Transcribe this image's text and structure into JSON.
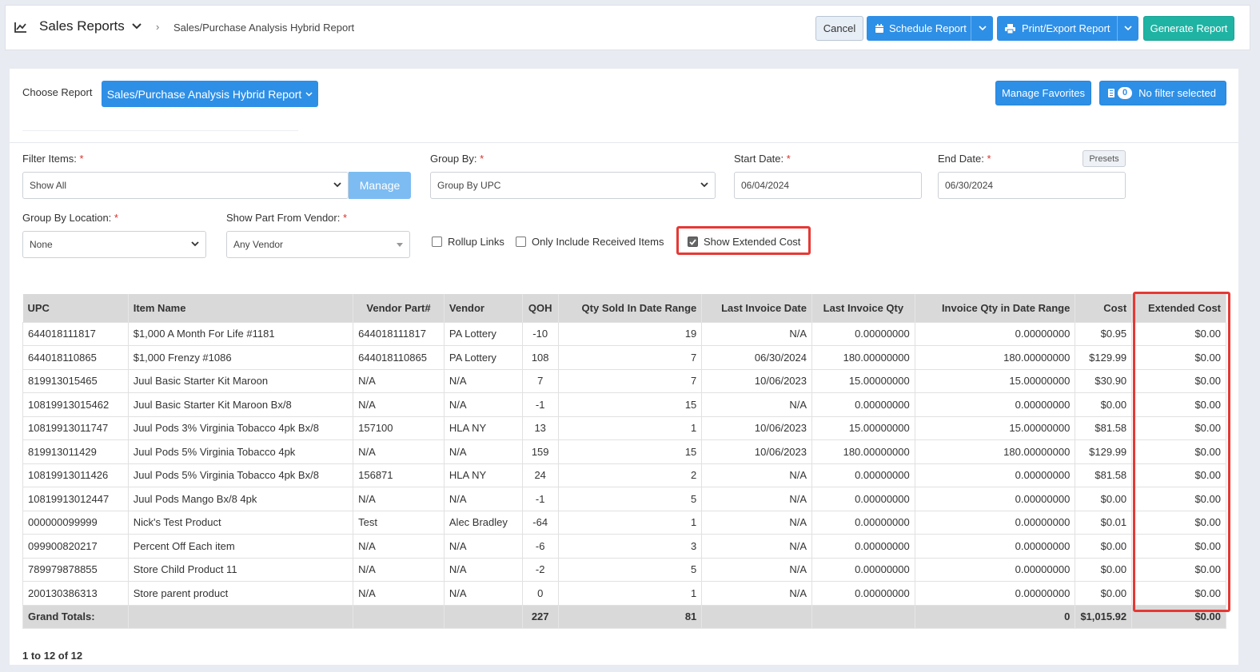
{
  "header": {
    "app_title": "Sales Reports",
    "breadcrumb": "Sales/Purchase Analysis Hybrid Report",
    "cancel_label": "Cancel",
    "schedule_label": "Schedule Report",
    "print_label": "Print/Export Report",
    "generate_label": "Generate Report"
  },
  "toolbar": {
    "choose_label": "Choose Report",
    "report_selected": "Sales/Purchase Analysis Hybrid Report",
    "favorites_label": "Manage Favorites",
    "filter_count": "0",
    "filter_label": "No filter selected"
  },
  "filters": {
    "filter_items_label": "Filter Items:",
    "filter_items_value": "Show All",
    "manage_label": "Manage",
    "group_by_label": "Group By:",
    "group_by_value": "Group By UPC",
    "start_date_label": "Start Date:",
    "start_date_value": "06/04/2024",
    "end_date_label": "End Date:",
    "end_date_value": "06/30/2024",
    "presets_label": "Presets",
    "group_location_label": "Group By Location:",
    "group_location_value": "None",
    "vendor_label": "Show Part From Vendor:",
    "vendor_value": "Any Vendor",
    "required_mark": "*",
    "rollup_label": "Rollup Links",
    "received_label": "Only Include Received Items",
    "extended_label": "Show Extended Cost",
    "rollup_checked": false,
    "received_checked": false,
    "extended_checked": true
  },
  "table": {
    "headers": [
      "UPC",
      "Item Name",
      "Vendor Part#",
      "Vendor",
      "QOH",
      "Qty Sold In Date Range",
      "Last Invoice Date",
      "Last Invoice Qty",
      "Invoice Qty in Date Range",
      "Cost",
      "Extended Cost"
    ],
    "rows": [
      [
        "644018111817",
        "$1,000 A Month For Life #1181",
        "644018111817",
        "PA Lottery",
        "-10",
        "19",
        "N/A",
        "0.00000000",
        "0.00000000",
        "$0.95",
        "$0.00"
      ],
      [
        "644018110865",
        "$1,000 Frenzy #1086",
        "644018110865",
        "PA Lottery",
        "108",
        "7",
        "06/30/2024",
        "180.00000000",
        "180.00000000",
        "$129.99",
        "$0.00"
      ],
      [
        "819913015465",
        "Juul Basic Starter Kit Maroon",
        "N/A",
        "N/A",
        "7",
        "7",
        "10/06/2023",
        "15.00000000",
        "15.00000000",
        "$30.90",
        "$0.00"
      ],
      [
        "10819913015462",
        "Juul Basic Starter Kit Maroon Bx/8",
        "N/A",
        "N/A",
        "-1",
        "15",
        "N/A",
        "0.00000000",
        "0.00000000",
        "$0.00",
        "$0.00"
      ],
      [
        "10819913011747",
        "Juul Pods 3% Virginia Tobacco 4pk Bx/8",
        "157100",
        "HLA NY",
        "13",
        "1",
        "10/06/2023",
        "15.00000000",
        "15.00000000",
        "$81.58",
        "$0.00"
      ],
      [
        "819913011429",
        "Juul Pods 5% Virginia Tobacco 4pk",
        "N/A",
        "N/A",
        "159",
        "15",
        "10/06/2023",
        "180.00000000",
        "180.00000000",
        "$129.99",
        "$0.00"
      ],
      [
        "10819913011426",
        "Juul Pods 5% Virginia Tobacco 4pk Bx/8",
        "156871",
        "HLA NY",
        "24",
        "2",
        "N/A",
        "0.00000000",
        "0.00000000",
        "$81.58",
        "$0.00"
      ],
      [
        "10819913012447",
        "Juul Pods Mango Bx/8 4pk",
        "N/A",
        "N/A",
        "-1",
        "5",
        "N/A",
        "0.00000000",
        "0.00000000",
        "$0.00",
        "$0.00"
      ],
      [
        "000000099999",
        "Nick's Test Product",
        "Test",
        "Alec Bradley",
        "-64",
        "1",
        "N/A",
        "0.00000000",
        "0.00000000",
        "$0.01",
        "$0.00"
      ],
      [
        "099900820217",
        "Percent Off Each item",
        "N/A",
        "N/A",
        "-6",
        "3",
        "N/A",
        "0.00000000",
        "0.00000000",
        "$0.00",
        "$0.00"
      ],
      [
        "789979878855",
        "Store Child Product 11",
        "N/A",
        "N/A",
        "-2",
        "5",
        "N/A",
        "0.00000000",
        "0.00000000",
        "$0.00",
        "$0.00"
      ],
      [
        "200130386313",
        "Store parent product",
        "N/A",
        "N/A",
        "0",
        "1",
        "N/A",
        "0.00000000",
        "0.00000000",
        "$0.00",
        "$0.00"
      ]
    ],
    "totals": [
      "Grand Totals:",
      "",
      "",
      "",
      "227",
      "81",
      "",
      "",
      "0",
      "$1,015.92",
      "$0.00"
    ]
  },
  "pager": {
    "summary": "1 to 12 of 12"
  },
  "colors": {
    "primary": "#2e8fe6",
    "teal": "#1fb3a3",
    "highlight": "#e53935"
  },
  "icons": [
    "chart-line-icon",
    "chevron-down-icon",
    "chevron-right-icon",
    "calendar-icon",
    "printer-icon",
    "filter-icon",
    "checkbox-icon"
  ]
}
